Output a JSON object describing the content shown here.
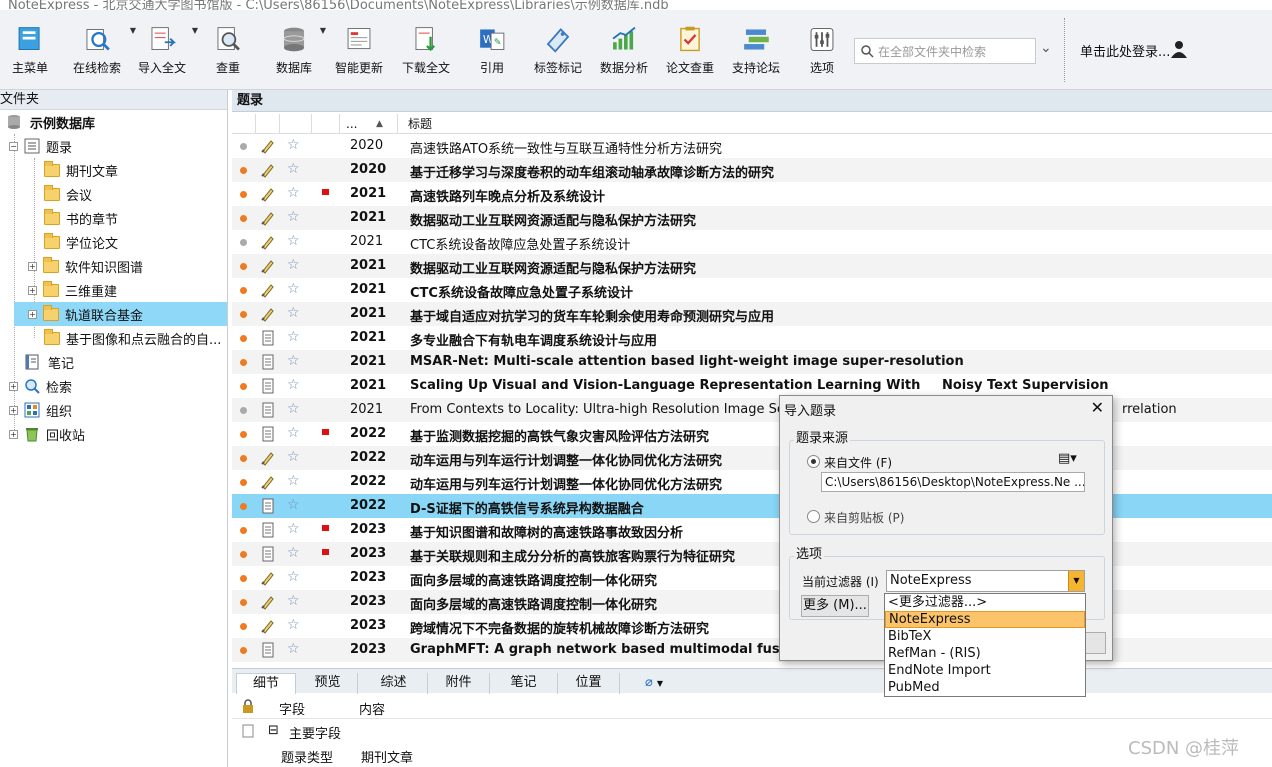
{
  "window": {
    "title": "NoteExpress - 北京交通大学图书馆版 - C:\\Users\\86156\\Documents\\NoteExpress\\Libraries\\示例数据库.ndb"
  },
  "toolbar": {
    "items": [
      {
        "label": "主菜单",
        "icon": "main-menu-icon",
        "has_dropdown": false
      },
      {
        "label": "在线检索",
        "icon": "online-search-icon",
        "has_dropdown": true
      },
      {
        "label": "导入全文",
        "icon": "import-fulltext-icon",
        "has_dropdown": true
      },
      {
        "label": "查重",
        "icon": "duplicate-check-icon",
        "has_dropdown": false
      },
      {
        "label": "数据库",
        "icon": "database-icon",
        "has_dropdown": true
      },
      {
        "label": "智能更新",
        "icon": "smart-update-icon",
        "has_dropdown": false
      },
      {
        "label": "下载全文",
        "icon": "download-fulltext-icon",
        "has_dropdown": false
      },
      {
        "label": "引用",
        "icon": "cite-icon",
        "has_dropdown": false
      },
      {
        "label": "标签标记",
        "icon": "tag-icon",
        "has_dropdown": false
      },
      {
        "label": "数据分析",
        "icon": "chart-icon",
        "has_dropdown": false
      },
      {
        "label": "论文查重",
        "icon": "paper-check-icon",
        "has_dropdown": false
      },
      {
        "label": "支持论坛",
        "icon": "forum-icon",
        "has_dropdown": false
      },
      {
        "label": "选项",
        "icon": "options-icon",
        "has_dropdown": false
      }
    ],
    "search_placeholder": "在全部文件夹中检索",
    "login_label": "单击此处登录..."
  },
  "sidebar": {
    "header": "文件夹",
    "items": [
      {
        "label": "示例数据库",
        "bold": true
      },
      {
        "label": "题录"
      },
      {
        "label": "期刊文章"
      },
      {
        "label": "会议"
      },
      {
        "label": "书的章节"
      },
      {
        "label": "学位论文"
      },
      {
        "label": "软件知识图谱"
      },
      {
        "label": "三维重建"
      },
      {
        "label": "轨道联合基金"
      },
      {
        "label": "基于图像和点云融合的自..."
      },
      {
        "label": "笔记"
      },
      {
        "label": "检索"
      },
      {
        "label": "组织"
      },
      {
        "label": "回收站"
      }
    ]
  },
  "main": {
    "header": "题录",
    "columns": {
      "year": "...",
      "title": "标题"
    },
    "rows": [
      {
        "year": "2020",
        "title": "高速铁路ATO系统一致性与互联互通特性分析方法研究",
        "bold": false,
        "dot": "#aaaaaa",
        "flag": false,
        "attach": "pen"
      },
      {
        "year": "2020",
        "title": "基于迁移学习与深度卷积的动车组滚动轴承故障诊断方法的研究",
        "bold": true,
        "dot": "#f07a22",
        "flag": false,
        "attach": "pen"
      },
      {
        "year": "2021",
        "title": "高速铁路列车晚点分析及系统设计",
        "bold": true,
        "dot": "#f07a22",
        "flag": true,
        "attach": "pen"
      },
      {
        "year": "2021",
        "title": "数据驱动工业互联网资源适配与隐私保护方法研究",
        "bold": true,
        "dot": "#f07a22",
        "flag": false,
        "attach": "pen"
      },
      {
        "year": "2021",
        "title": "CTC系统设备故障应急处置子系统设计",
        "bold": false,
        "dot": "#aaaaaa",
        "flag": false,
        "attach": "pen"
      },
      {
        "year": "2021",
        "title": "数据驱动工业互联网资源适配与隐私保护方法研究",
        "bold": true,
        "dot": "#f07a22",
        "flag": false,
        "attach": "pen"
      },
      {
        "year": "2021",
        "title": "CTC系统设备故障应急处置子系统设计",
        "bold": true,
        "dot": "#f07a22",
        "flag": false,
        "attach": "pen"
      },
      {
        "year": "2021",
        "title": "基于域自适应对抗学习的货车车轮剩余使用寿命预测研究与应用",
        "bold": true,
        "dot": "#f07a22",
        "flag": false,
        "attach": "pen"
      },
      {
        "year": "2021",
        "title": "多专业融合下有轨电车调度系统设计与应用",
        "bold": true,
        "dot": "#f07a22",
        "flag": false,
        "attach": "doc"
      },
      {
        "year": "2021",
        "title": "MSAR-Net: Multi-scale attention based light-weight image super-resolution",
        "bold": true,
        "dot": "#f07a22",
        "flag": false,
        "attach": "doc"
      },
      {
        "year": "2021",
        "title": "Scaling Up Visual and Vision-Language Representation Learning With",
        "title_b": "Noisy Text Supervision",
        "bold": true,
        "dot": "#f07a22",
        "flag": false,
        "attach": "doc"
      },
      {
        "year": "2021",
        "title": "From Contexts to Locality: Ultra-high Resolution Image Segm",
        "title_c": "rrelation",
        "bold": false,
        "dot": "#aaaaaa",
        "flag": false,
        "attach": "doc"
      },
      {
        "year": "2022",
        "title": "基于监测数据挖掘的高铁气象灾害风险评估方法研究",
        "bold": true,
        "dot": "#f07a22",
        "flag": true,
        "attach": "doc"
      },
      {
        "year": "2022",
        "title": "动车运用与列车运行计划调整一体化协同优化方法研究",
        "bold": true,
        "dot": "#f07a22",
        "flag": false,
        "attach": "pen"
      },
      {
        "year": "2022",
        "title": "动车运用与列车运行计划调整一体化协同优化方法研究",
        "bold": true,
        "dot": "#f07a22",
        "flag": false,
        "attach": "pen"
      },
      {
        "year": "2022",
        "title": "D-S证据下的高铁信号系统异构数据融合",
        "bold": true,
        "dot": "#f07a22",
        "flag": false,
        "attach": "doc",
        "selected": true
      },
      {
        "year": "2023",
        "title": "基于知识图谱和故障树的高速铁路事故致因分析",
        "bold": true,
        "dot": "#f07a22",
        "flag": true,
        "attach": "doc"
      },
      {
        "year": "2023",
        "title": "基于关联规则和主成分分析的高铁旅客购票行为特征研究",
        "bold": true,
        "dot": "#f07a22",
        "flag": true,
        "attach": "doc"
      },
      {
        "year": "2023",
        "title": "面向多层域的高速铁路调度控制一体化研究",
        "bold": true,
        "dot": "#f07a22",
        "flag": false,
        "attach": "pen"
      },
      {
        "year": "2023",
        "title": "面向多层域的高速铁路调度控制一体化研究",
        "bold": true,
        "dot": "#f07a22",
        "flag": false,
        "attach": "pen"
      },
      {
        "year": "2023",
        "title": "跨域情况下不完备数据的旋转机械故障诊断方法研究",
        "bold": true,
        "dot": "#f07a22",
        "flag": false,
        "attach": "pen"
      },
      {
        "year": "2023",
        "title": "GraphMFT: A graph network based multimodal fusion t",
        "bold": true,
        "dot": "#f07a22",
        "flag": false,
        "attach": "doc"
      }
    ]
  },
  "bottom": {
    "tabs": [
      "细节",
      "预览",
      "综述",
      "附件",
      "笔记",
      "位置"
    ],
    "detail_columns": {
      "field": "字段",
      "content": "内容"
    },
    "section": "主要字段",
    "rows": [
      {
        "field": "题录类型",
        "content": "期刊文章"
      }
    ]
  },
  "dialog": {
    "title": "导入题录",
    "source_group": "题录来源",
    "from_file": "来自文件 (F)",
    "file_path": "C:\\Users\\86156\\Desktop\\NoteExpress.Ne ...",
    "from_clipboard": "来自剪贴板 (P)",
    "options_group": "选项",
    "filter_label": "当前过滤器 (I)",
    "filter_value": "NoteExpress",
    "more_button": "更多 (M)...",
    "dropdown_options": [
      "<更多过滤器...>",
      "NoteExpress",
      "BibTeX",
      "RefMan - (RIS)",
      "EndNote Import",
      "PubMed"
    ]
  },
  "watermark": "CSDN @桂萍",
  "colors": {
    "selected_row": "#89d6f6",
    "unread_dot": "#f07a22",
    "read_dot": "#aaaaaa",
    "flag": "#dd1111",
    "dropdown_highlight": "#fbc46b"
  }
}
